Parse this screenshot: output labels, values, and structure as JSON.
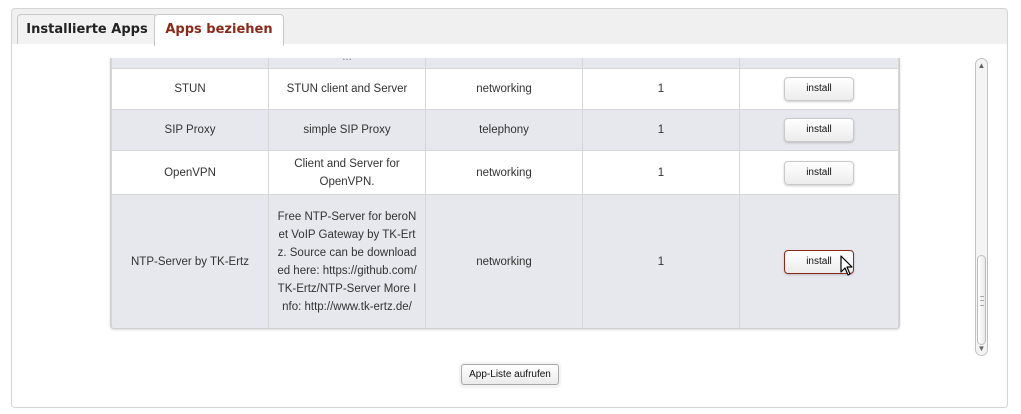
{
  "tabs": [
    {
      "label": "Installierte Apps",
      "active": false
    },
    {
      "label": "Apps beziehen",
      "active": true
    }
  ],
  "table": {
    "partial_row": {
      "description": "...",
      "category": "",
      "version": ""
    },
    "rows": [
      {
        "name": "STUN",
        "description": "STUN client and Server",
        "category": "networking",
        "version": "1",
        "action": "install"
      },
      {
        "name": "SIP Proxy",
        "description": "simple SIP Proxy",
        "category": "telephony",
        "version": "1",
        "action": "install"
      },
      {
        "name": "OpenVPN",
        "description": "Client and Server for OpenVPN.",
        "category": "networking",
        "version": "1",
        "action": "install"
      },
      {
        "name": "NTP-Server by TK-Ertz",
        "description": "Free NTP-Server for beroNet VoIP Gateway by TK-Ertz. Source can be downloaded here: https://github.com/TK-Ertz/NTP-Server More Info: http://www.tk-ertz.de/",
        "category": "networking",
        "version": "1",
        "action": "install"
      }
    ]
  },
  "app_list_button": "App-Liste aufrufen",
  "colors": {
    "accent": "#8a2a1a",
    "row_alt": "#e7e8ee",
    "border": "#d6d6d6"
  },
  "icons": {
    "scroll_up": "scroll-up-arrow-icon",
    "scroll_down": "scroll-down-arrow-icon",
    "cursor": "mouse-pointer-icon"
  }
}
